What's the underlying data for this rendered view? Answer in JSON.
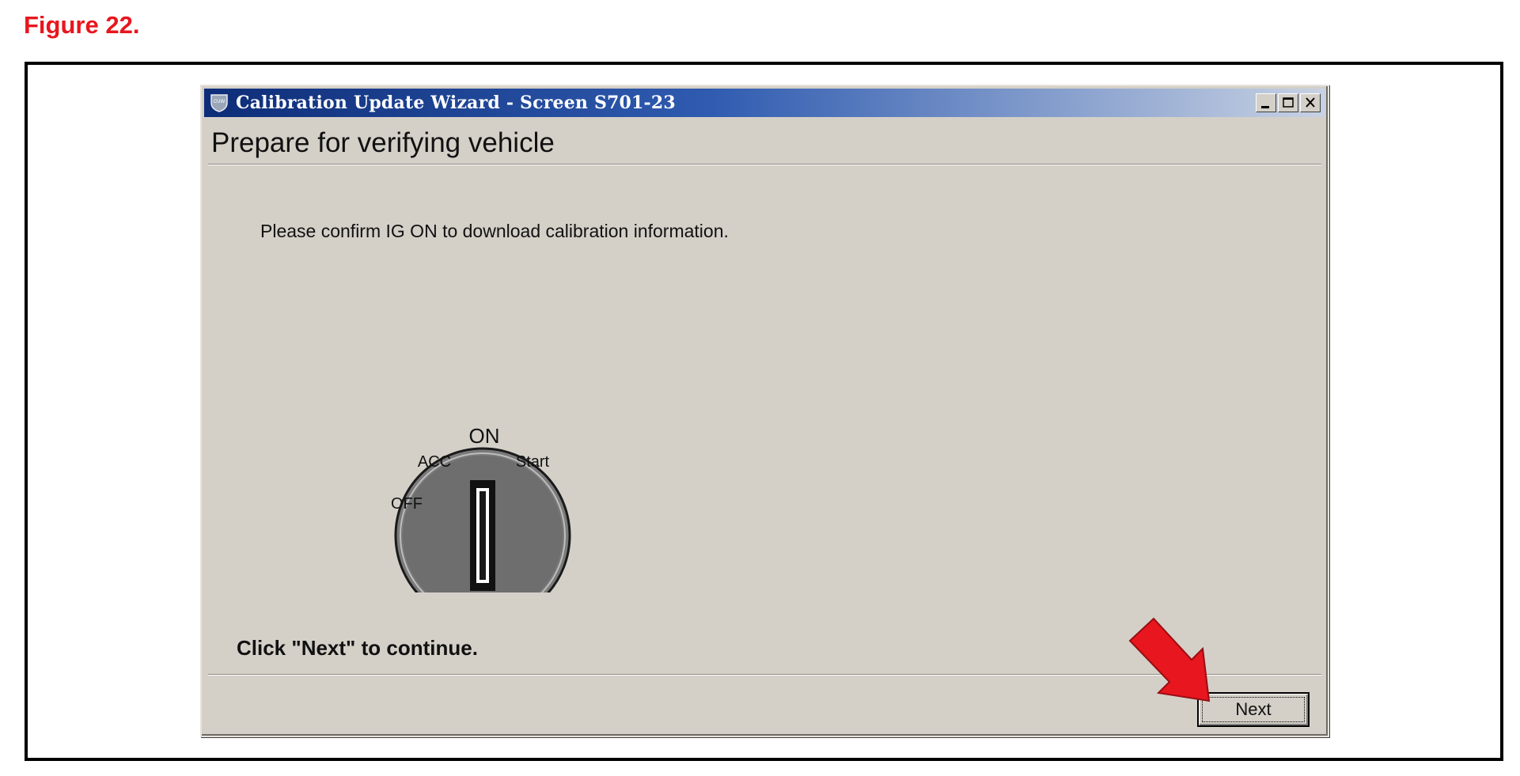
{
  "figure": {
    "label": "Figure 22."
  },
  "window": {
    "title": "Calibration Update Wizard - Screen S701-23",
    "icon": "cuw-shield-icon",
    "controls": [
      "minimize-icon",
      "maximize-icon",
      "close-icon"
    ]
  },
  "page": {
    "title": "Prepare for verifying vehicle",
    "instruction": "Please confirm IG ON to download calibration information.",
    "continue_text": "Click \"Next\" to continue."
  },
  "ignition": {
    "positions": {
      "off": "OFF",
      "acc": "ACC",
      "on": "ON",
      "start": "Start"
    },
    "selected": "ON"
  },
  "footer": {
    "next_label": "Next"
  },
  "colors": {
    "figure_label": "#e8161e",
    "titlebar_start": "#0e2d78",
    "titlebar_end": "#c8d2e3",
    "window_face": "#d4d0c8",
    "arrow": "#e8161e"
  }
}
